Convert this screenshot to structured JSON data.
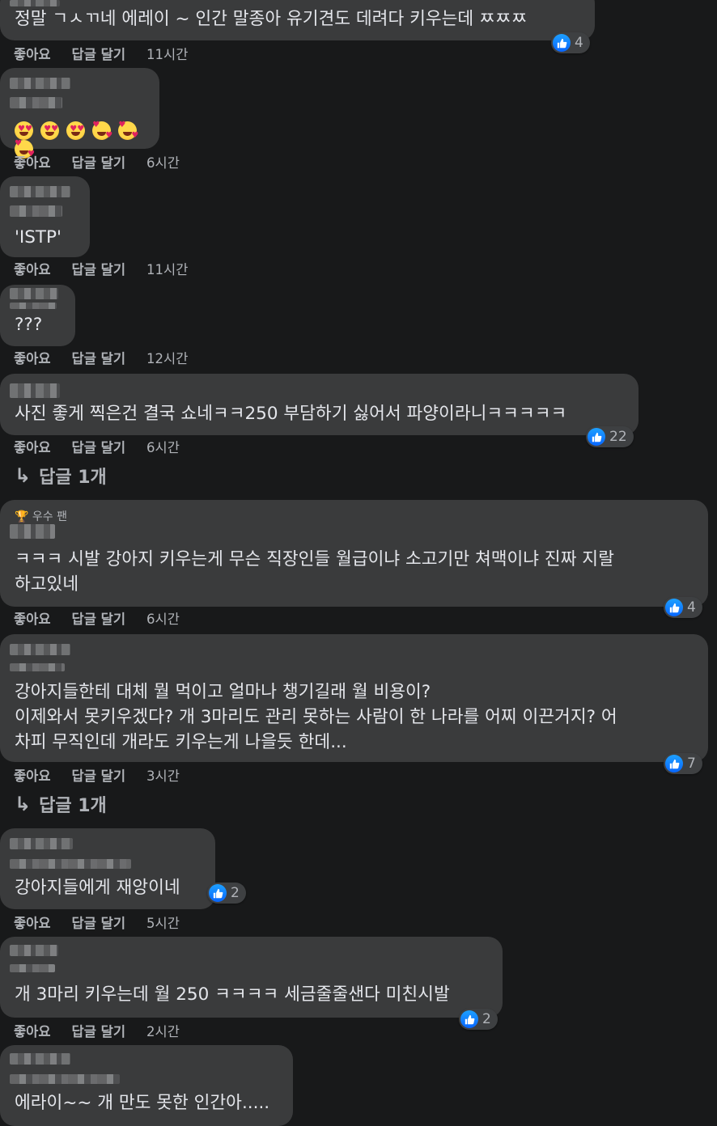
{
  "actions": {
    "like": "좋아요",
    "reply": "답글 달기"
  },
  "comments": [
    {
      "text": "정말 ㄱㅅㄲ네 에레이 ~ 인간 말종아 유기견도 데려다 키우는데 ㅉㅉㅉ",
      "time": "11시간",
      "reactions": "4"
    },
    {
      "text": "",
      "emoji": [
        "heart-eyes",
        "heart-eyes",
        "heart-eyes",
        "smiling-hearts",
        "smiling-hearts",
        "smiling-hearts"
      ],
      "time": "6시간"
    },
    {
      "text": "'ISTP'",
      "time": "11시간"
    },
    {
      "text": "???",
      "time": "12시간"
    },
    {
      "text": "사진 좋게 찍은건 결국 쇼네ㅋㅋ250 부담하기 싫어서 파양이라니ㅋㅋㅋㅋㅋ",
      "time": "6시간",
      "reactions": "22",
      "replies": "답글 1개"
    },
    {
      "badge": "🏆 우수 팬",
      "text": "ㅋㅋㅋ 시발 강아지 키우는게 무슨 직장인들 월급이냐 소고기만 쳐맥이냐 진짜 지랄\n하고있네",
      "time": "6시간",
      "reactions": "4"
    },
    {
      "text": "강아지들한테 대체 뭘 먹이고 얼마나 챙기길래 월 비용이?\n이제와서 못키우겠다? 개 3마리도 관리 못하는 사람이 한 나라를 어찌 이끈거지? 어\n차피 무직인데 개라도 키우는게 나을듯 한데...",
      "time": "3시간",
      "reactions": "7",
      "replies": "답글 1개"
    },
    {
      "text": "강아지들에게 재앙이네",
      "time": "5시간",
      "reactions": "2"
    },
    {
      "text": "개 3마리 키우는데 월 250 ㅋㅋㅋㅋ 세금줄줄샌다 미친시발",
      "time": "2시간",
      "reactions": "2"
    },
    {
      "text": "에라이~~ 개 만도 못한 인간아....."
    }
  ]
}
